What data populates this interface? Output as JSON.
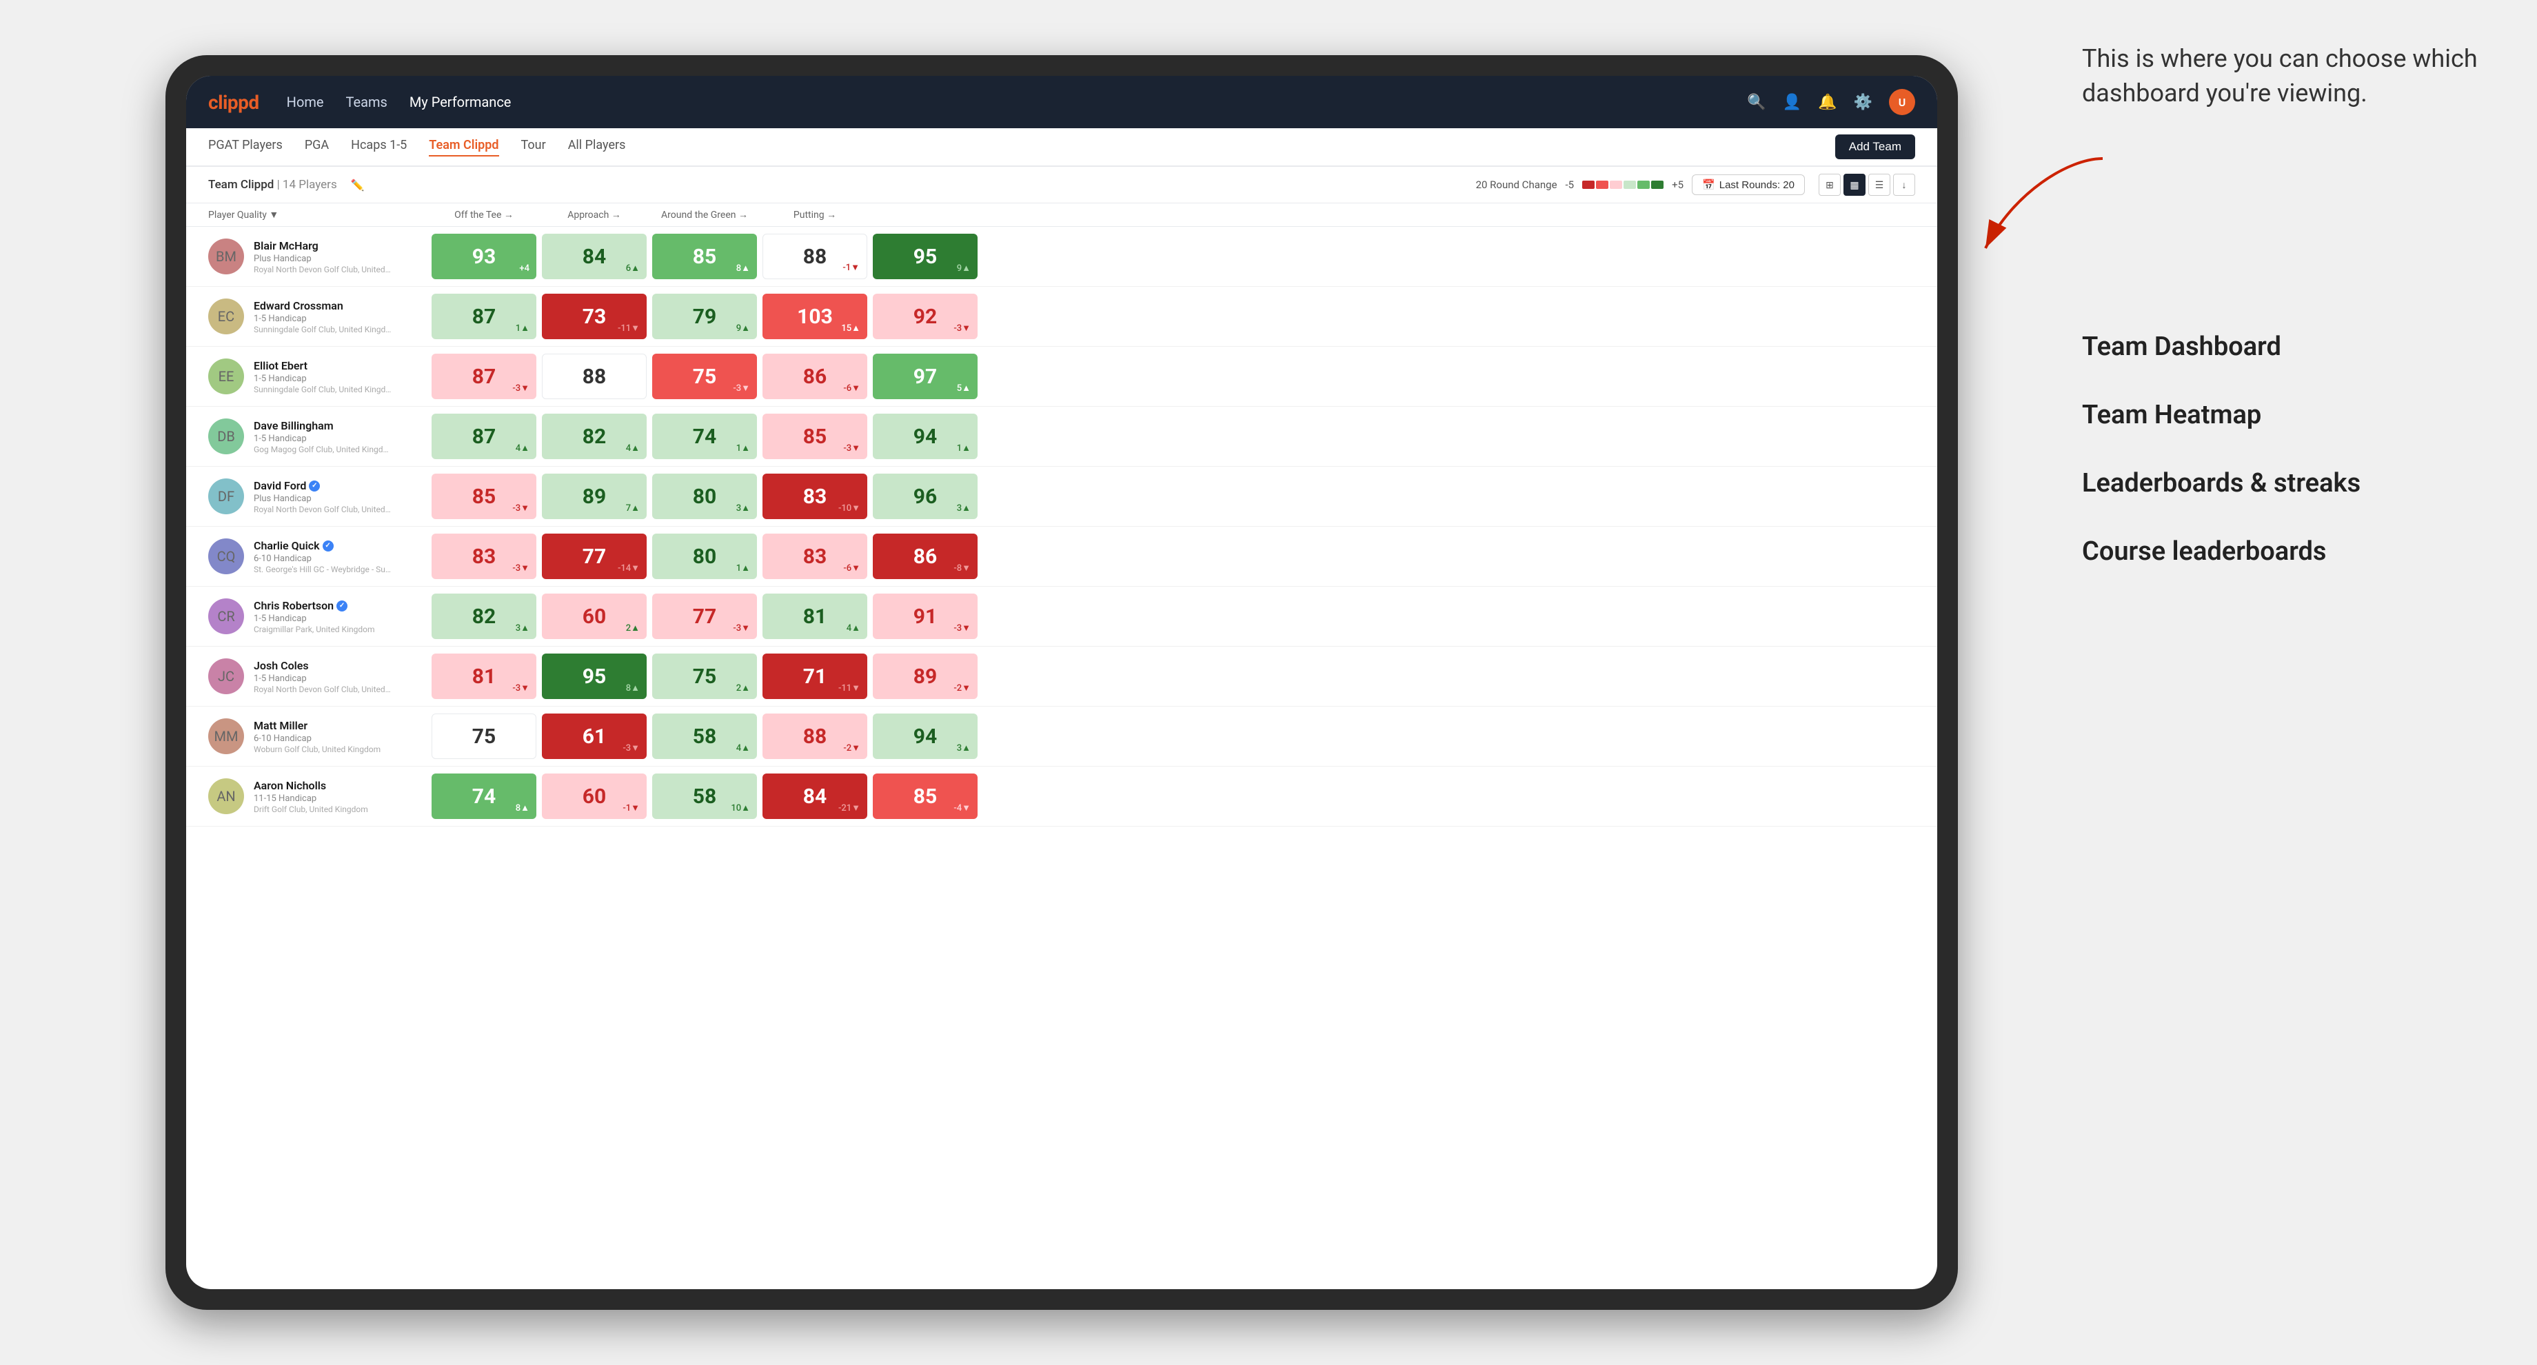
{
  "annotation": {
    "intro": "This is where you can choose which dashboard you're viewing.",
    "options": [
      "Team Dashboard",
      "Team Heatmap",
      "Leaderboards & streaks",
      "Course leaderboards"
    ]
  },
  "nav": {
    "logo": "clippd",
    "links": [
      "Home",
      "Teams",
      "My Performance"
    ],
    "active_link": "My Performance"
  },
  "sub_nav": {
    "links": [
      "PGAT Players",
      "PGA",
      "Hcaps 1-5",
      "Team Clippd",
      "Tour",
      "All Players"
    ],
    "active_link": "Team Clippd",
    "add_team_label": "Add Team"
  },
  "team_header": {
    "name": "Team Clippd",
    "separator": "|",
    "count": "14 Players",
    "round_change_label": "20 Round Change",
    "range_low": "-5",
    "range_high": "+5",
    "last_rounds_label": "Last Rounds:",
    "last_rounds_value": "20"
  },
  "columns": {
    "player_quality": "Player Quality ▼",
    "off_tee": "Off the Tee →",
    "approach": "Approach →",
    "around_green": "Around the Green →",
    "putting": "Putting →"
  },
  "players": [
    {
      "name": "Blair McHarg",
      "handicap": "Plus Handicap",
      "club": "Royal North Devon Golf Club, United Kingdom",
      "verified": false,
      "scores": {
        "quality": {
          "value": 93,
          "change": "+4",
          "direction": "up",
          "bg": "green-med"
        },
        "off_tee": {
          "value": 84,
          "change": "6▲",
          "direction": "up",
          "bg": "green-light"
        },
        "approach": {
          "value": 85,
          "change": "8▲",
          "direction": "up",
          "bg": "green-med"
        },
        "around_green": {
          "value": 88,
          "change": "-1▼",
          "direction": "down",
          "bg": "white"
        },
        "putting": {
          "value": 95,
          "change": "9▲",
          "direction": "up",
          "bg": "green-dark"
        }
      }
    },
    {
      "name": "Edward Crossman",
      "handicap": "1-5 Handicap",
      "club": "Sunningdale Golf Club, United Kingdom",
      "verified": false,
      "scores": {
        "quality": {
          "value": 87,
          "change": "1▲",
          "direction": "up",
          "bg": "green-light"
        },
        "off_tee": {
          "value": 73,
          "change": "-11▼",
          "direction": "down",
          "bg": "red-dark"
        },
        "approach": {
          "value": 79,
          "change": "9▲",
          "direction": "up",
          "bg": "green-light"
        },
        "around_green": {
          "value": 103,
          "change": "15▲",
          "direction": "up",
          "bg": "red-med"
        },
        "putting": {
          "value": 92,
          "change": "-3▼",
          "direction": "down",
          "bg": "red-light"
        }
      }
    },
    {
      "name": "Elliot Ebert",
      "handicap": "1-5 Handicap",
      "club": "Sunningdale Golf Club, United Kingdom",
      "verified": false,
      "scores": {
        "quality": {
          "value": 87,
          "change": "-3▼",
          "direction": "down",
          "bg": "red-light"
        },
        "off_tee": {
          "value": 88,
          "change": "",
          "direction": "none",
          "bg": "white"
        },
        "approach": {
          "value": 75,
          "change": "-3▼",
          "direction": "down",
          "bg": "red-med"
        },
        "around_green": {
          "value": 86,
          "change": "-6▼",
          "direction": "down",
          "bg": "red-light"
        },
        "putting": {
          "value": 97,
          "change": "5▲",
          "direction": "up",
          "bg": "green-med"
        }
      }
    },
    {
      "name": "Dave Billingham",
      "handicap": "1-5 Handicap",
      "club": "Gog Magog Golf Club, United Kingdom",
      "verified": false,
      "scores": {
        "quality": {
          "value": 87,
          "change": "4▲",
          "direction": "up",
          "bg": "green-light"
        },
        "off_tee": {
          "value": 82,
          "change": "4▲",
          "direction": "up",
          "bg": "green-light"
        },
        "approach": {
          "value": 74,
          "change": "1▲",
          "direction": "up",
          "bg": "green-light"
        },
        "around_green": {
          "value": 85,
          "change": "-3▼",
          "direction": "down",
          "bg": "red-light"
        },
        "putting": {
          "value": 94,
          "change": "1▲",
          "direction": "up",
          "bg": "green-light"
        }
      }
    },
    {
      "name": "David Ford",
      "handicap": "Plus Handicap",
      "club": "Royal North Devon Golf Club, United Kingdom",
      "verified": true,
      "scores": {
        "quality": {
          "value": 85,
          "change": "-3▼",
          "direction": "down",
          "bg": "red-light"
        },
        "off_tee": {
          "value": 89,
          "change": "7▲",
          "direction": "up",
          "bg": "green-light"
        },
        "approach": {
          "value": 80,
          "change": "3▲",
          "direction": "up",
          "bg": "green-light"
        },
        "around_green": {
          "value": 83,
          "change": "-10▼",
          "direction": "down",
          "bg": "red-dark"
        },
        "putting": {
          "value": 96,
          "change": "3▲",
          "direction": "up",
          "bg": "green-light"
        }
      }
    },
    {
      "name": "Charlie Quick",
      "handicap": "6-10 Handicap",
      "club": "St. George's Hill GC - Weybridge - Surrey, Uni...",
      "verified": true,
      "scores": {
        "quality": {
          "value": 83,
          "change": "-3▼",
          "direction": "down",
          "bg": "red-light"
        },
        "off_tee": {
          "value": 77,
          "change": "-14▼",
          "direction": "down",
          "bg": "red-dark"
        },
        "approach": {
          "value": 80,
          "change": "1▲",
          "direction": "up",
          "bg": "green-light"
        },
        "around_green": {
          "value": 83,
          "change": "-6▼",
          "direction": "down",
          "bg": "red-light"
        },
        "putting": {
          "value": 86,
          "change": "-8▼",
          "direction": "down",
          "bg": "red-dark"
        }
      }
    },
    {
      "name": "Chris Robertson",
      "handicap": "1-5 Handicap",
      "club": "Craigmillar Park, United Kingdom",
      "verified": true,
      "scores": {
        "quality": {
          "value": 82,
          "change": "3▲",
          "direction": "up",
          "bg": "green-light"
        },
        "off_tee": {
          "value": 60,
          "change": "2▲",
          "direction": "up",
          "bg": "red-light"
        },
        "approach": {
          "value": 77,
          "change": "-3▼",
          "direction": "down",
          "bg": "red-light"
        },
        "around_green": {
          "value": 81,
          "change": "4▲",
          "direction": "up",
          "bg": "green-light"
        },
        "putting": {
          "value": 91,
          "change": "-3▼",
          "direction": "down",
          "bg": "red-light"
        }
      }
    },
    {
      "name": "Josh Coles",
      "handicap": "1-5 Handicap",
      "club": "Royal North Devon Golf Club, United Kingdom",
      "verified": false,
      "scores": {
        "quality": {
          "value": 81,
          "change": "-3▼",
          "direction": "down",
          "bg": "red-light"
        },
        "off_tee": {
          "value": 95,
          "change": "8▲",
          "direction": "up",
          "bg": "green-dark"
        },
        "approach": {
          "value": 75,
          "change": "2▲",
          "direction": "up",
          "bg": "green-light"
        },
        "around_green": {
          "value": 71,
          "change": "-11▼",
          "direction": "down",
          "bg": "red-dark"
        },
        "putting": {
          "value": 89,
          "change": "-2▼",
          "direction": "down",
          "bg": "red-light"
        }
      }
    },
    {
      "name": "Matt Miller",
      "handicap": "6-10 Handicap",
      "club": "Woburn Golf Club, United Kingdom",
      "verified": false,
      "scores": {
        "quality": {
          "value": 75,
          "change": "",
          "direction": "none",
          "bg": "white"
        },
        "off_tee": {
          "value": 61,
          "change": "-3▼",
          "direction": "down",
          "bg": "red-dark"
        },
        "approach": {
          "value": 58,
          "change": "4▲",
          "direction": "up",
          "bg": "green-light"
        },
        "around_green": {
          "value": 88,
          "change": "-2▼",
          "direction": "down",
          "bg": "red-light"
        },
        "putting": {
          "value": 94,
          "change": "3▲",
          "direction": "up",
          "bg": "green-light"
        }
      }
    },
    {
      "name": "Aaron Nicholls",
      "handicap": "11-15 Handicap",
      "club": "Drift Golf Club, United Kingdom",
      "verified": false,
      "scores": {
        "quality": {
          "value": 74,
          "change": "8▲",
          "direction": "up",
          "bg": "green-med"
        },
        "off_tee": {
          "value": 60,
          "change": "-1▼",
          "direction": "down",
          "bg": "red-light"
        },
        "approach": {
          "value": 58,
          "change": "10▲",
          "direction": "up",
          "bg": "green-light"
        },
        "around_green": {
          "value": 84,
          "change": "-21▼",
          "direction": "down",
          "bg": "red-dark"
        },
        "putting": {
          "value": 85,
          "change": "-4▼",
          "direction": "down",
          "bg": "red-med"
        }
      }
    }
  ]
}
